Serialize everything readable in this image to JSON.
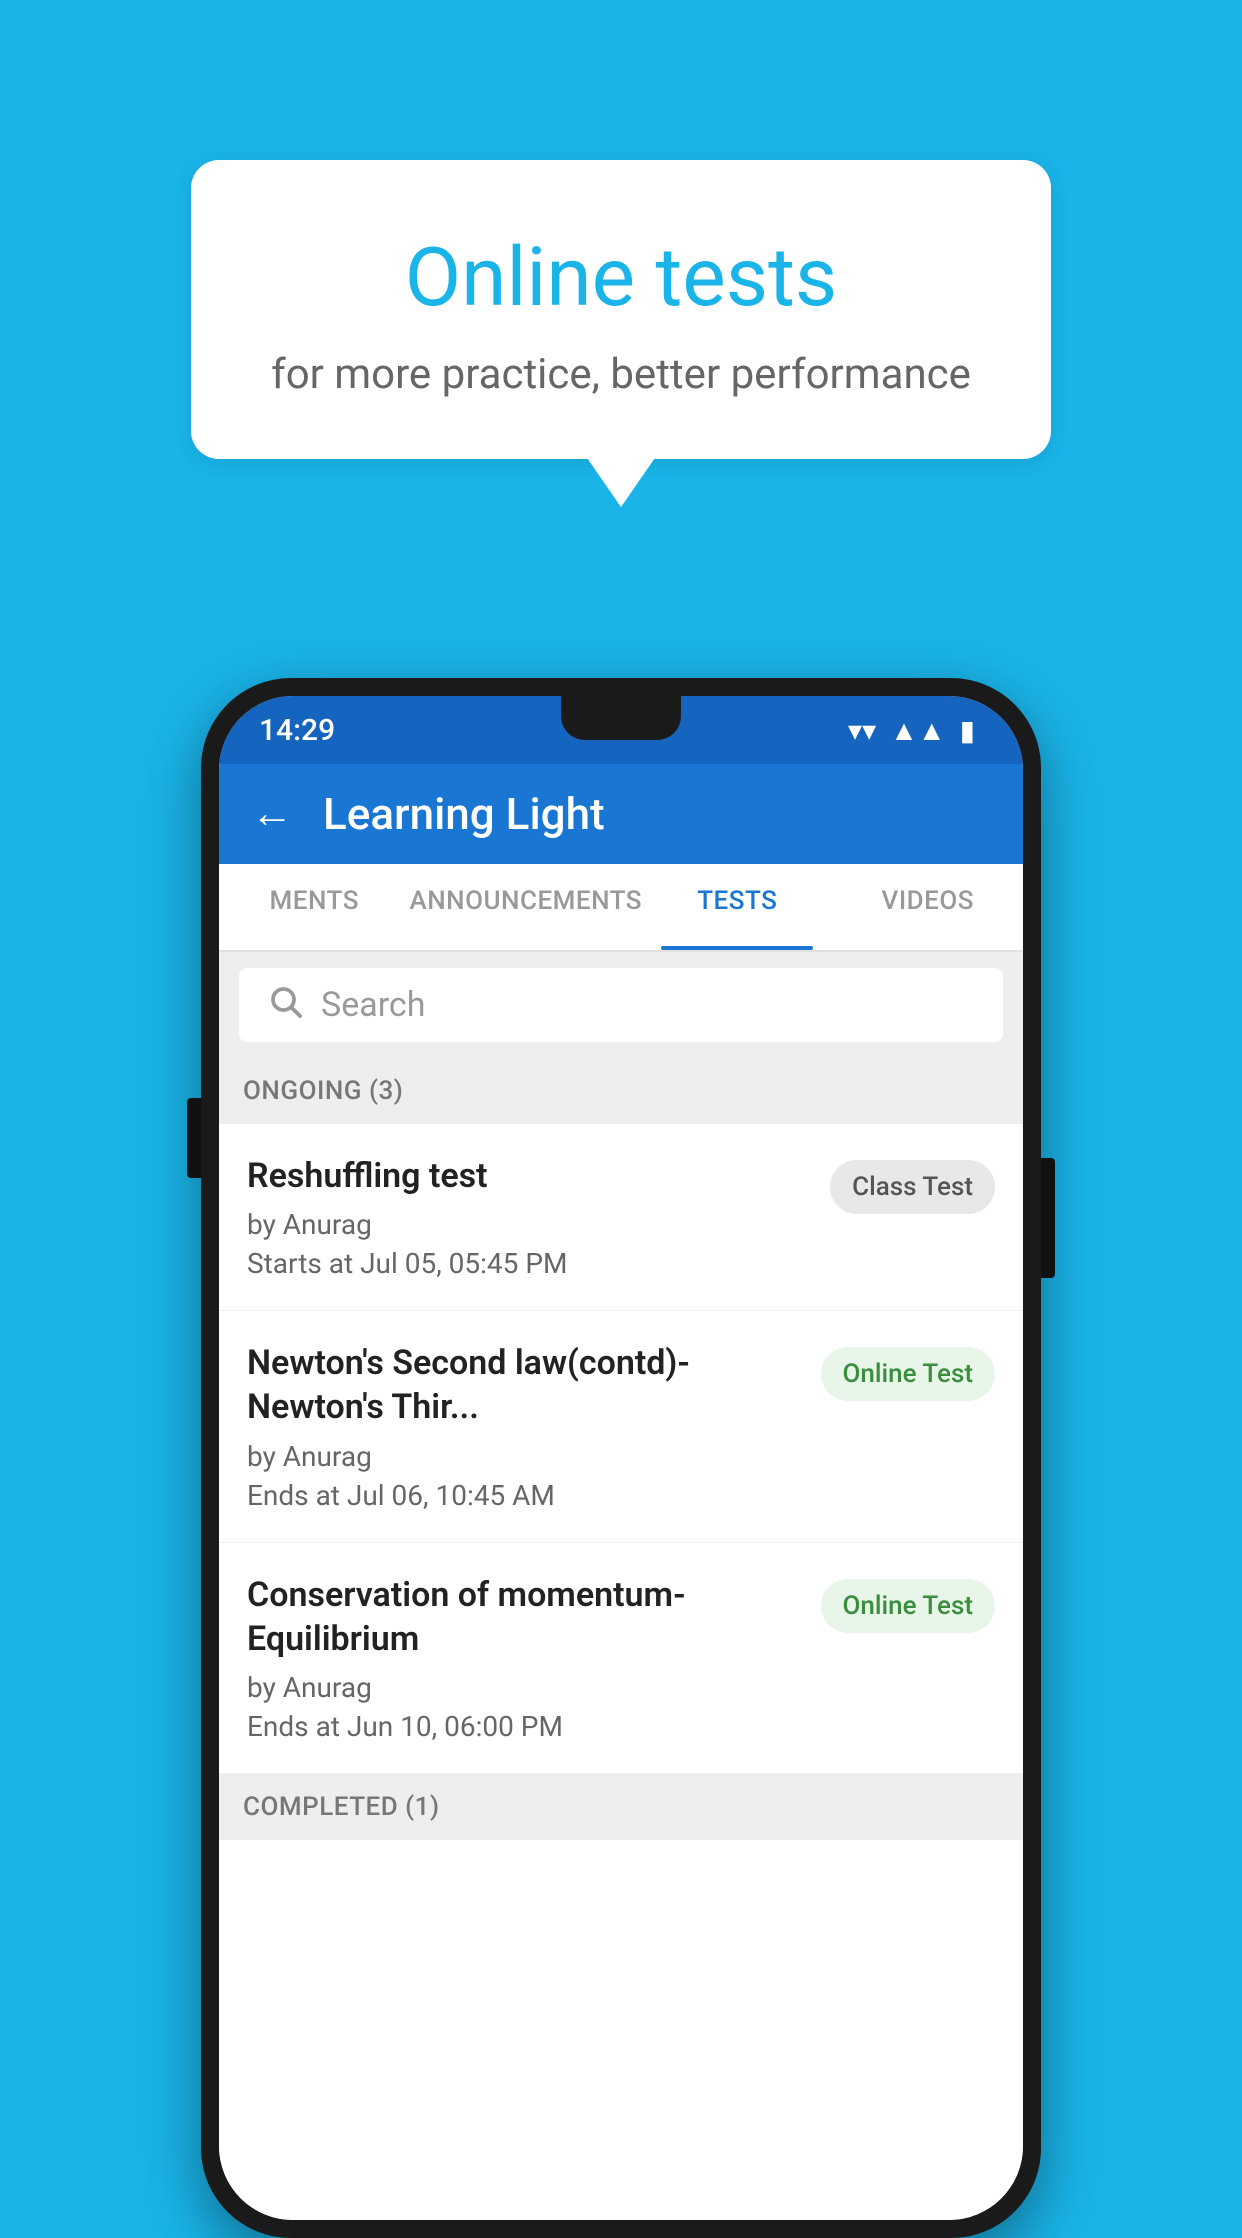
{
  "background": {
    "color": "#1ab4e8"
  },
  "speech_bubble": {
    "title": "Online tests",
    "subtitle": "for more practice, better performance"
  },
  "status_bar": {
    "time": "14:29",
    "wifi": "▼",
    "signal": "▲",
    "battery": "▮"
  },
  "app_bar": {
    "back_label": "←",
    "title": "Learning Light"
  },
  "tabs": [
    {
      "label": "MENTS",
      "active": false
    },
    {
      "label": "ANNOUNCEMENTS",
      "active": false
    },
    {
      "label": "TESTS",
      "active": true
    },
    {
      "label": "VIDEOS",
      "active": false
    }
  ],
  "search": {
    "placeholder": "Search"
  },
  "ongoing_section": {
    "label": "ONGOING (3)"
  },
  "tests": [
    {
      "title": "Reshuffling test",
      "author": "by Anurag",
      "date": "Starts at  Jul 05, 05:45 PM",
      "badge": "Class Test",
      "badge_type": "class"
    },
    {
      "title": "Newton's Second law(contd)-Newton's Thir...",
      "author": "by Anurag",
      "date": "Ends at  Jul 06, 10:45 AM",
      "badge": "Online Test",
      "badge_type": "online"
    },
    {
      "title": "Conservation of momentum-Equilibrium",
      "author": "by Anurag",
      "date": "Ends at  Jun 10, 06:00 PM",
      "badge": "Online Test",
      "badge_type": "online"
    }
  ],
  "completed_section": {
    "label": "COMPLETED (1)"
  }
}
